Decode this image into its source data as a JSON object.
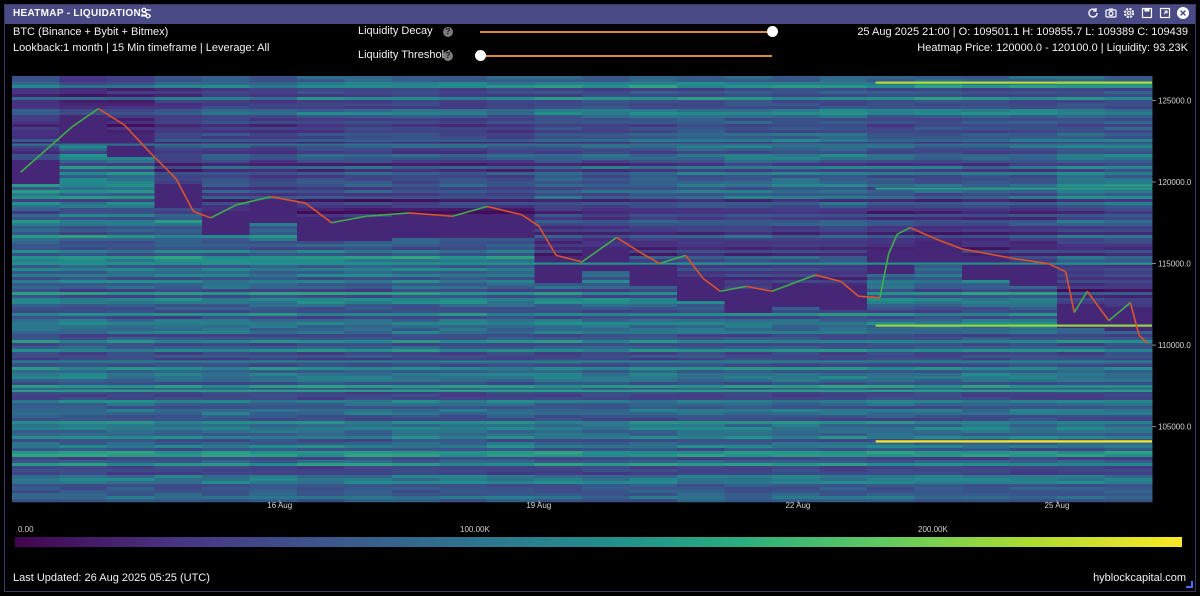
{
  "window": {
    "title": "HEATMAP - LIQUIDATIONS",
    "icons": [
      "settings-sliders-icon",
      "refresh-icon",
      "camera-icon",
      "gear-icon",
      "save-icon",
      "expand-icon",
      "close-icon"
    ]
  },
  "info": {
    "pair": "BTC (Binance + Bybit + Bitmex)",
    "lookback": "Lookback:1 month | 15 Min timeframe | Leverage: All",
    "ohlc": "25 Aug 2025 21:00 | O: 109501.1 H: 109855.7 L: 109389 C: 109439",
    "heatmap_price": "Heatmap Price: 120000.0 - 120100.0 | Liquidity: 93.23K"
  },
  "controls": {
    "decay_label": "Liquidity Decay",
    "threshold_label": "Liquidity Threshold",
    "decay_value": 1.0,
    "threshold_value": 0.0,
    "help_glyph": "?"
  },
  "colors": {
    "low": "#3d0a55",
    "mid": "#21918c",
    "high": "#fde725",
    "price_up": "#3fae4a",
    "price_down": "#d9542c"
  },
  "chart_data": {
    "type": "heatmap",
    "title": "",
    "xlabel": "",
    "ylabel": "",
    "x_ticks": [
      "16 Aug",
      "19 Aug",
      "22 Aug",
      "25 Aug"
    ],
    "y_ticks": [
      "125000.0",
      "120000.0",
      "115000.0",
      "110000.0",
      "105000.0"
    ],
    "ylim": [
      100500,
      126500
    ],
    "x_range_days": [
      12.9,
      26.1
    ],
    "colorbar": {
      "ticks": [
        "0.00",
        "100.00K",
        "200.00K"
      ],
      "range": [
        0,
        250000
      ]
    },
    "price_series": [
      {
        "day": 13.0,
        "price": 120600
      },
      {
        "day": 13.3,
        "price": 122000
      },
      {
        "day": 13.6,
        "price": 123400
      },
      {
        "day": 13.9,
        "price": 124500
      },
      {
        "day": 14.2,
        "price": 123500
      },
      {
        "day": 14.5,
        "price": 121800
      },
      {
        "day": 14.8,
        "price": 120200
      },
      {
        "day": 15.0,
        "price": 118200
      },
      {
        "day": 15.2,
        "price": 117800
      },
      {
        "day": 15.5,
        "price": 118600
      },
      {
        "day": 15.9,
        "price": 119100
      },
      {
        "day": 16.3,
        "price": 118700
      },
      {
        "day": 16.6,
        "price": 117500
      },
      {
        "day": 17.0,
        "price": 117900
      },
      {
        "day": 17.5,
        "price": 118100
      },
      {
        "day": 18.0,
        "price": 117900
      },
      {
        "day": 18.4,
        "price": 118500
      },
      {
        "day": 18.8,
        "price": 118000
      },
      {
        "day": 19.0,
        "price": 117300
      },
      {
        "day": 19.2,
        "price": 115500
      },
      {
        "day": 19.5,
        "price": 115100
      },
      {
        "day": 19.9,
        "price": 116600
      },
      {
        "day": 20.2,
        "price": 115600
      },
      {
        "day": 20.4,
        "price": 115000
      },
      {
        "day": 20.7,
        "price": 115500
      },
      {
        "day": 20.9,
        "price": 114100
      },
      {
        "day": 21.1,
        "price": 113300
      },
      {
        "day": 21.4,
        "price": 113600
      },
      {
        "day": 21.7,
        "price": 113300
      },
      {
        "day": 21.9,
        "price": 113700
      },
      {
        "day": 22.2,
        "price": 114300
      },
      {
        "day": 22.5,
        "price": 113900
      },
      {
        "day": 22.7,
        "price": 113000
      },
      {
        "day": 22.95,
        "price": 112900
      },
      {
        "day": 23.05,
        "price": 115600
      },
      {
        "day": 23.15,
        "price": 116800
      },
      {
        "day": 23.3,
        "price": 117200
      },
      {
        "day": 23.6,
        "price": 116500
      },
      {
        "day": 23.9,
        "price": 115900
      },
      {
        "day": 24.2,
        "price": 115600
      },
      {
        "day": 24.5,
        "price": 115300
      },
      {
        "day": 24.9,
        "price": 115000
      },
      {
        "day": 25.1,
        "price": 114500
      },
      {
        "day": 25.2,
        "price": 112000
      },
      {
        "day": 25.35,
        "price": 113300
      },
      {
        "day": 25.6,
        "price": 111500
      },
      {
        "day": 25.85,
        "price": 112600
      },
      {
        "day": 25.95,
        "price": 110600
      },
      {
        "day": 26.05,
        "price": 110100
      }
    ],
    "bright_levels": [
      {
        "price": 126100,
        "from_day": 22.9,
        "intensity": 0.9
      },
      {
        "price": 119600,
        "from_day": 22.9,
        "intensity": 0.6
      },
      {
        "price": 111200,
        "from_day": 22.9,
        "intensity": 0.85
      },
      {
        "price": 104100,
        "from_day": 22.9,
        "intensity": 1.0
      },
      {
        "price": 115000,
        "from_day": 12.9,
        "intensity": 0.55
      },
      {
        "price": 109000,
        "from_day": 12.9,
        "intensity": 0.5
      },
      {
        "price": 107200,
        "from_day": 12.9,
        "intensity": 0.6
      },
      {
        "price": 122300,
        "from_day": 12.9,
        "intensity": 0.45
      }
    ]
  },
  "footer": {
    "last_updated": "Last Updated: 26 Aug 2025 05:25 (UTC)",
    "brand": "hyblockcapital.com"
  }
}
